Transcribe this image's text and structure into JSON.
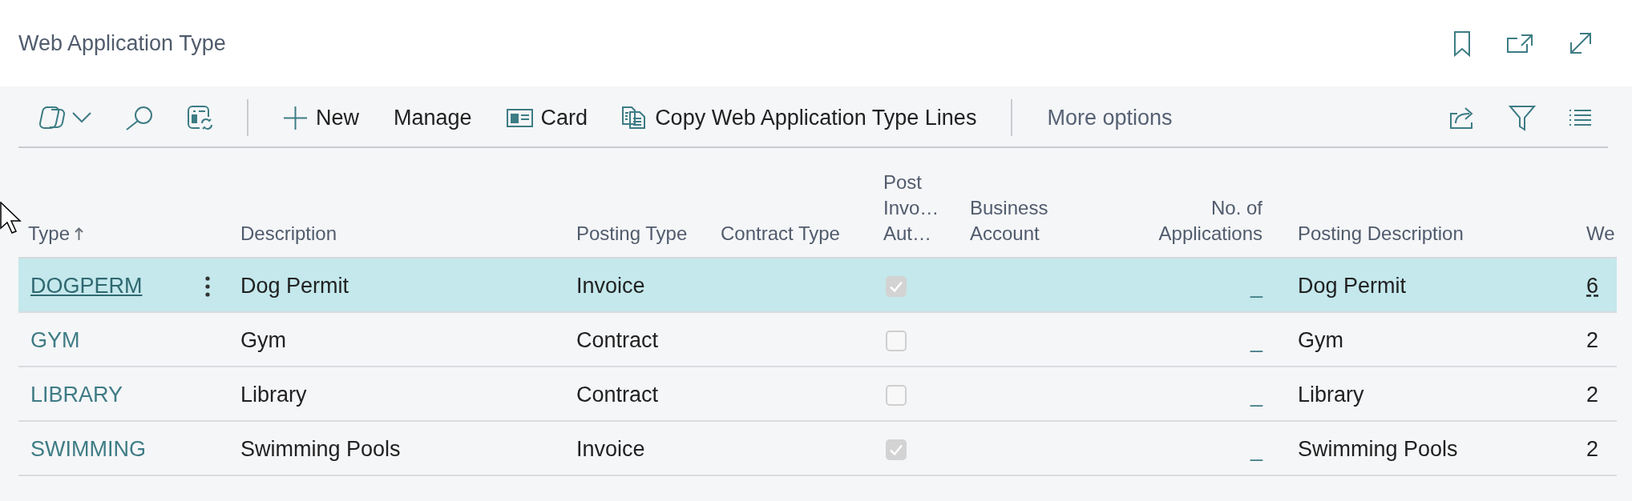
{
  "page": {
    "title": "Web Application Type"
  },
  "toolbar": {
    "actions": [
      {
        "kind": "new",
        "label": "New"
      },
      {
        "kind": "text",
        "label": "Manage"
      },
      {
        "kind": "card",
        "label": "Card"
      },
      {
        "kind": "copy",
        "label": "Copy Web Application Type Lines"
      }
    ],
    "more": "More options"
  },
  "table": {
    "columns": [
      {
        "label": "Type",
        "sorted": true
      },
      {
        "label": "Description",
        "sorted": false
      },
      {
        "label": "Posting Type",
        "sorted": false
      },
      {
        "label": "Contract Type",
        "sorted": false
      },
      {
        "label": "Post Invo… Aut…",
        "sorted": false
      },
      {
        "label": "Business Account",
        "sorted": false
      },
      {
        "label": "No. of Applications",
        "sorted": false
      },
      {
        "label": "Posting Description",
        "sorted": false
      },
      {
        "label": "We",
        "sorted": false
      }
    ],
    "rows": [
      {
        "selected": true,
        "type": "DOGPERM",
        "description": "Dog Permit",
        "posting_type": "Invoice",
        "post_invo_aut": true,
        "no_of_applications": "_",
        "posting_description": "Dog Permit",
        "column_9": "6"
      },
      {
        "selected": false,
        "type": "GYM",
        "description": "Gym",
        "posting_type": "Contract",
        "post_invo_aut": false,
        "no_of_applications": "_",
        "posting_description": "Gym",
        "column_9": "2"
      },
      {
        "selected": false,
        "type": "LIBRARY",
        "description": "Library",
        "posting_type": "Contract",
        "post_invo_aut": false,
        "no_of_applications": "_",
        "posting_description": "Library",
        "column_9": "2"
      },
      {
        "selected": false,
        "type": "SWIMMING",
        "description": "Swimming Pools",
        "posting_type": "Invoice",
        "post_invo_aut": true,
        "no_of_applications": "_",
        "posting_description": "Swimming Pools",
        "column_9": "2"
      }
    ]
  }
}
